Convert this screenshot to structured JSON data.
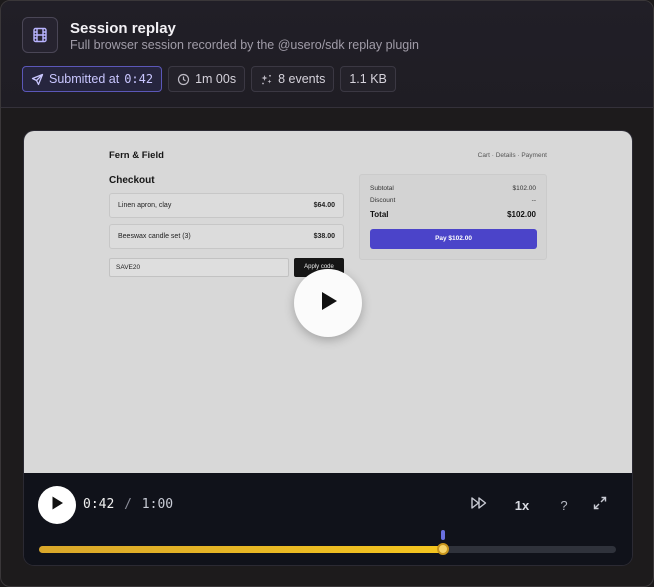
{
  "header": {
    "title": "Session replay",
    "subtitle": "Full browser session recorded by the @usero/sdk replay plugin",
    "icon": "film-icon",
    "chips": {
      "submitted_label": "Submitted at",
      "submitted_time": "0:42",
      "duration": "1m 00s",
      "events": "8 events",
      "size": "1.1 KB"
    }
  },
  "replay_page": {
    "brand": "Fern & Field",
    "steps": "Cart · Details · Payment",
    "heading": "Checkout",
    "items": [
      {
        "name": "Linen apron, clay",
        "price": "$64.00"
      },
      {
        "name": "Beeswax candle set (3)",
        "price": "$38.00"
      }
    ],
    "promo_value": "SAVE20",
    "apply_label": "Apply code",
    "summary": {
      "subtotal_label": "Subtotal",
      "subtotal": "$102.00",
      "discount_label": "Discount",
      "discount": "--",
      "total_label": "Total",
      "total": "$102.00",
      "pay_label": "Pay $102.00"
    }
  },
  "controls": {
    "current_time": "0:42",
    "separator": "/",
    "duration": "1:00",
    "speed": "1x",
    "help": "?",
    "progress": 0.7,
    "event_marker_position": 0.7
  },
  "colors": {
    "accent": "#5b57b8",
    "progress_fill": "#f4c51f",
    "pay_button": "#4b44c9"
  }
}
